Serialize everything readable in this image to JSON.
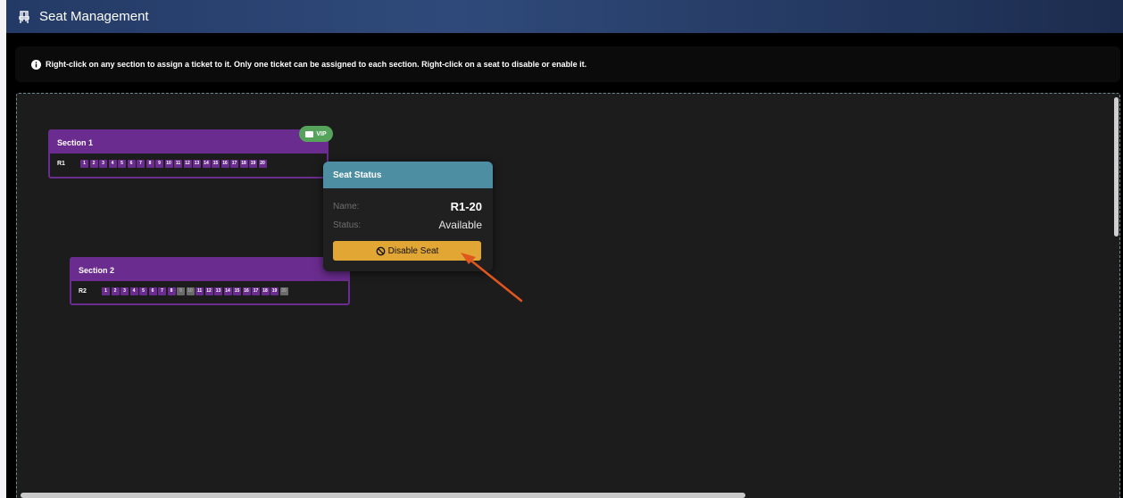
{
  "window": {
    "title": "Seat Management",
    "icon": "chair-icon"
  },
  "info": {
    "icon": "info-circle-icon",
    "text": "Right-click on any section to assign a ticket to it. Only one ticket can be assigned to each section. Right-click on a seat to disable or enable it."
  },
  "sections": [
    {
      "name": "Section 1",
      "badge": "VIP",
      "row": {
        "label": "R1",
        "seats": [
          "1",
          "2",
          "3",
          "4",
          "5",
          "6",
          "7",
          "8",
          "9",
          "10",
          "11",
          "12",
          "13",
          "14",
          "15",
          "16",
          "17",
          "18",
          "19",
          "20"
        ],
        "disabled": []
      }
    },
    {
      "name": "Section 2",
      "row": {
        "label": "R2",
        "seats": [
          "1",
          "2",
          "3",
          "4",
          "5",
          "6",
          "7",
          "8",
          "9",
          "10",
          "11",
          "12",
          "13",
          "14",
          "15",
          "16",
          "17",
          "18",
          "19",
          "20"
        ],
        "disabled": [
          "9",
          "10",
          "20"
        ]
      }
    }
  ],
  "seat_status": {
    "title": "Seat Status",
    "name_label": "Name:",
    "name_value": "R1-20",
    "status_label": "Status:",
    "status_value": "Available",
    "button_label": "Disable Seat",
    "button_icon": "ban-icon"
  },
  "colors": {
    "section": "#6a2c8e",
    "seat_disabled": "#6a6a6a",
    "vip_badge": "#56a35c",
    "popup_header": "#4e8ea3",
    "disable_button": "#e2a634",
    "annotation_arrow": "#e0571e"
  }
}
